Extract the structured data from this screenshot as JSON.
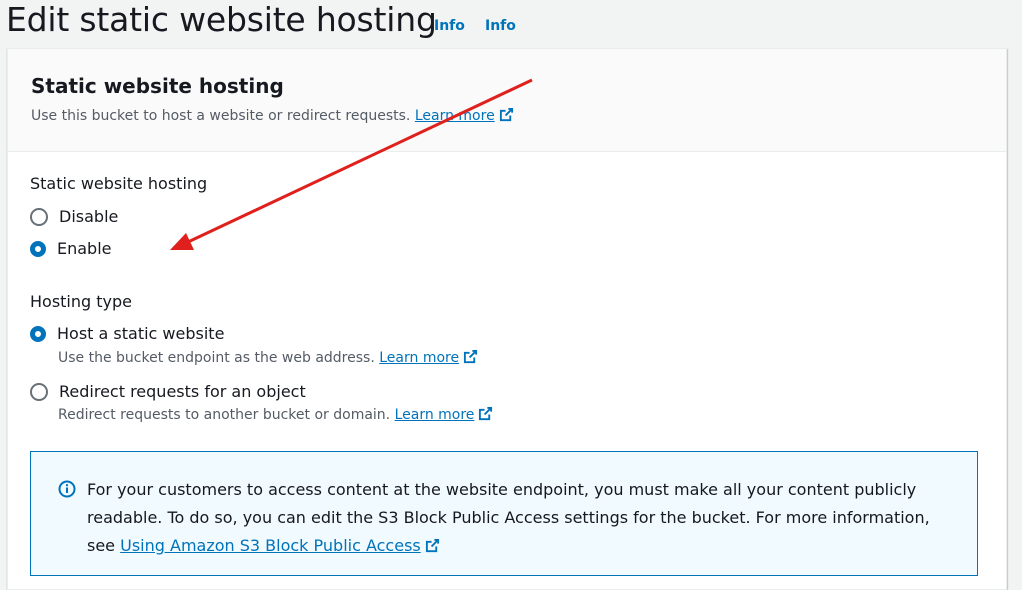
{
  "header": {
    "title": "Edit static website hosting",
    "info_links": [
      "Info",
      "Info"
    ]
  },
  "panel": {
    "title": "Static website hosting",
    "description": "Use this bucket to host a website or redirect requests.",
    "learn_more": "Learn more"
  },
  "hosting": {
    "label": "Static website hosting",
    "options": [
      {
        "label": "Disable",
        "checked": false
      },
      {
        "label": "Enable",
        "checked": true
      }
    ]
  },
  "hosting_type": {
    "label": "Hosting type",
    "options": [
      {
        "label": "Host a static website",
        "description": "Use the bucket endpoint as the web address.",
        "learn_more": "Learn more",
        "checked": true
      },
      {
        "label": "Redirect requests for an object",
        "description": "Redirect requests to another bucket or domain.",
        "learn_more": "Learn more",
        "checked": false
      }
    ]
  },
  "alert": {
    "text": "For your customers to access content at the website endpoint, you must make all your content publicly readable. To do so, you can edit the S3 Block Public Access settings for the bucket. For more information, see",
    "link": "Using Amazon S3 Block Public Access"
  },
  "colors": {
    "accent": "#0073bb",
    "annotation_arrow": "#e0201c"
  },
  "icons": {
    "external_link": "external-link-icon",
    "info": "info-icon",
    "annotation": "annotation-arrow"
  }
}
